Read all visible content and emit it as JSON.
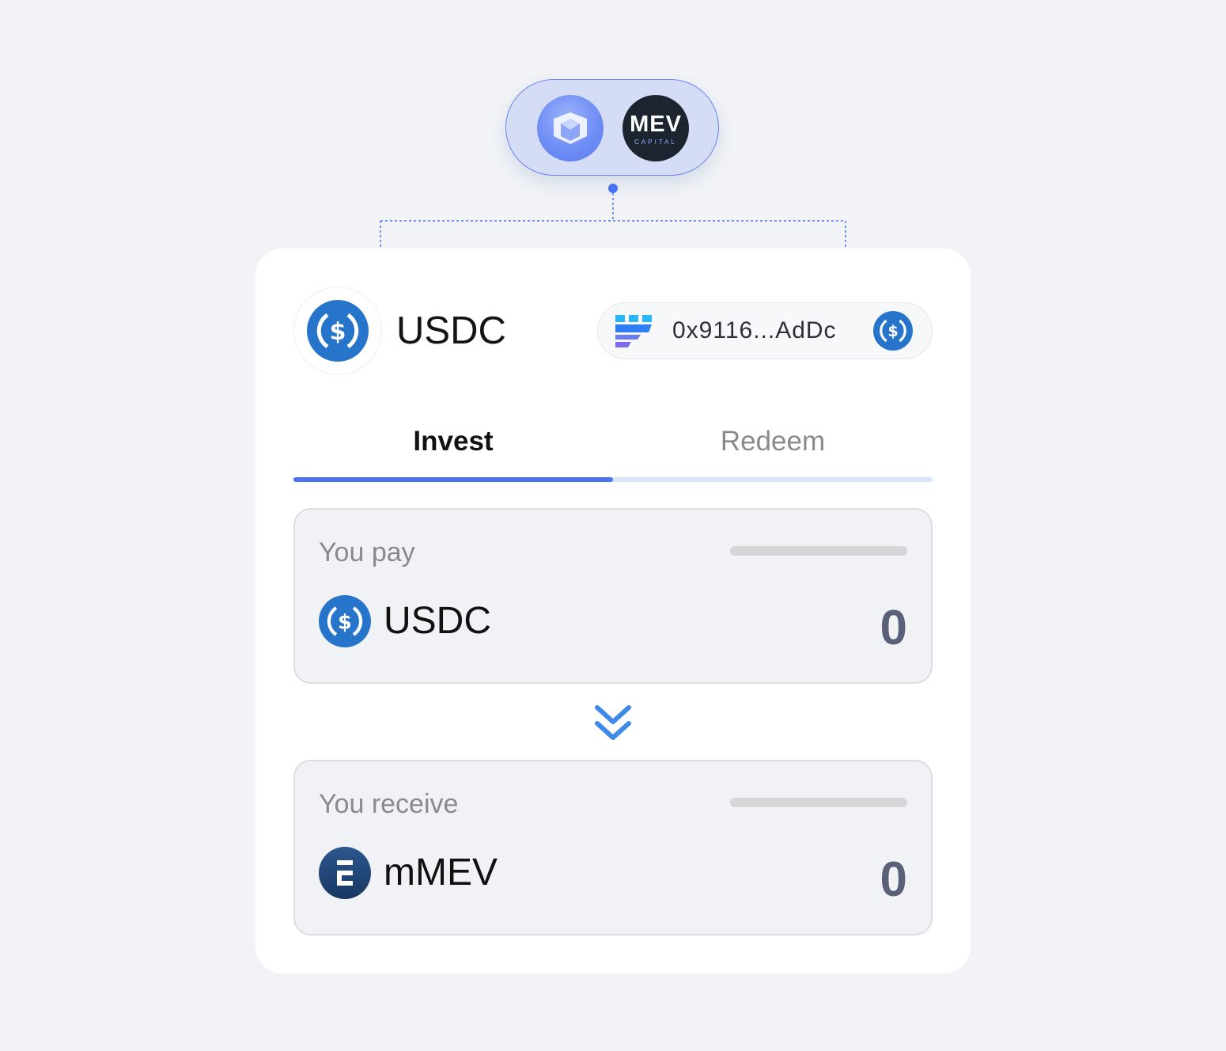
{
  "partners": {
    "mev_logo_text": "MEV",
    "mev_logo_sub": "CAPITAL"
  },
  "header": {
    "token_name": "USDC",
    "contract_address": "0x9116...AdDc"
  },
  "tabs": [
    {
      "label": "Invest",
      "active": true
    },
    {
      "label": "Redeem",
      "active": false
    }
  ],
  "pay": {
    "label": "You pay",
    "token": "USDC",
    "amount": "0"
  },
  "receive": {
    "label": "You receive",
    "token": "mMEV",
    "amount": "0"
  },
  "icons": {
    "partner_1": "midas-logo-icon",
    "partner_2": "mev-capital-logo-icon",
    "header_token": "usdc-icon",
    "chain": "chain-logo-icon",
    "address_token": "usdc-icon",
    "pay_token": "usdc-icon",
    "receive_token": "mmev-icon",
    "swap": "double-chevron-down-icon"
  },
  "colors": {
    "accent": "#4a73f4",
    "usdc_blue": "#2775ca",
    "amount_text": "#5b6079",
    "background": "#f1f3f6"
  }
}
